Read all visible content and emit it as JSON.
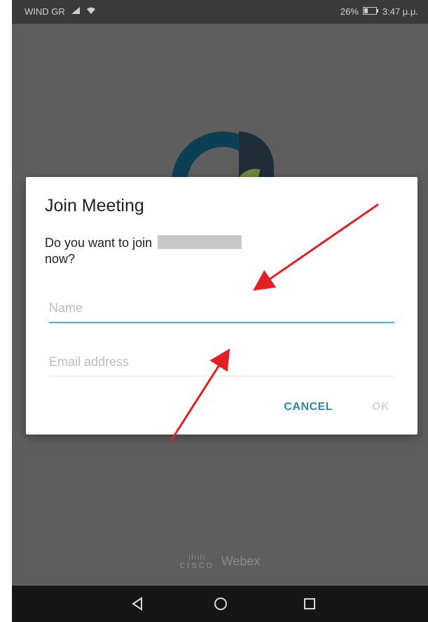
{
  "status_bar": {
    "carrier": "WIND GR",
    "battery": "26%",
    "time": "3:47 μ.μ."
  },
  "dialog": {
    "title": "Join Meeting",
    "message_prefix": "Do you want to join",
    "message_suffix": "now?",
    "name_placeholder": "Name",
    "email_placeholder": "Email address",
    "cancel_label": "CANCEL",
    "ok_label": "OK"
  },
  "branding": {
    "cisco_label": "cisco",
    "webex_label": "Webex"
  },
  "colors": {
    "accent": "#4fb0cf",
    "button": "#2e86ad",
    "annotation_arrow": "#e31e24"
  },
  "icons": [
    "signal-icon",
    "wifi-icon",
    "battery-icon",
    "back-icon",
    "home-icon",
    "recents-icon",
    "cisco-logo-icon"
  ]
}
